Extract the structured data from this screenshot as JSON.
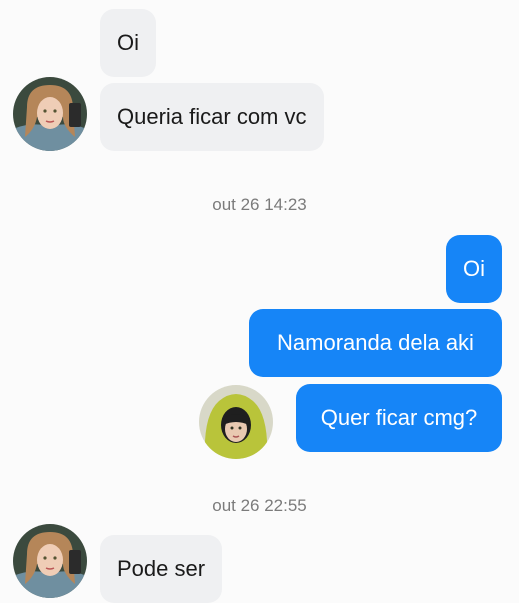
{
  "conversation": {
    "messages": [
      {
        "from": "other",
        "text": "Oi"
      },
      {
        "from": "other",
        "text": "Queria ficar com vc"
      },
      {
        "from": "me",
        "text": "Oi"
      },
      {
        "from": "me",
        "text": "Namoranda dela aki"
      },
      {
        "from": "me",
        "text": "Quer ficar cmg?"
      },
      {
        "from": "other",
        "text": "Pode ser"
      }
    ],
    "timestamps": [
      "out 26 14:23",
      "out 26 22:55"
    ]
  },
  "avatars": {
    "other": "profile-photo-icon",
    "me": "profile-photo-icon"
  },
  "colors": {
    "outgoing_bubble": "#1685f7",
    "incoming_bubble": "#eff0f2",
    "timestamp_text": "#7b7b7b",
    "background": "#fbfbfb"
  }
}
